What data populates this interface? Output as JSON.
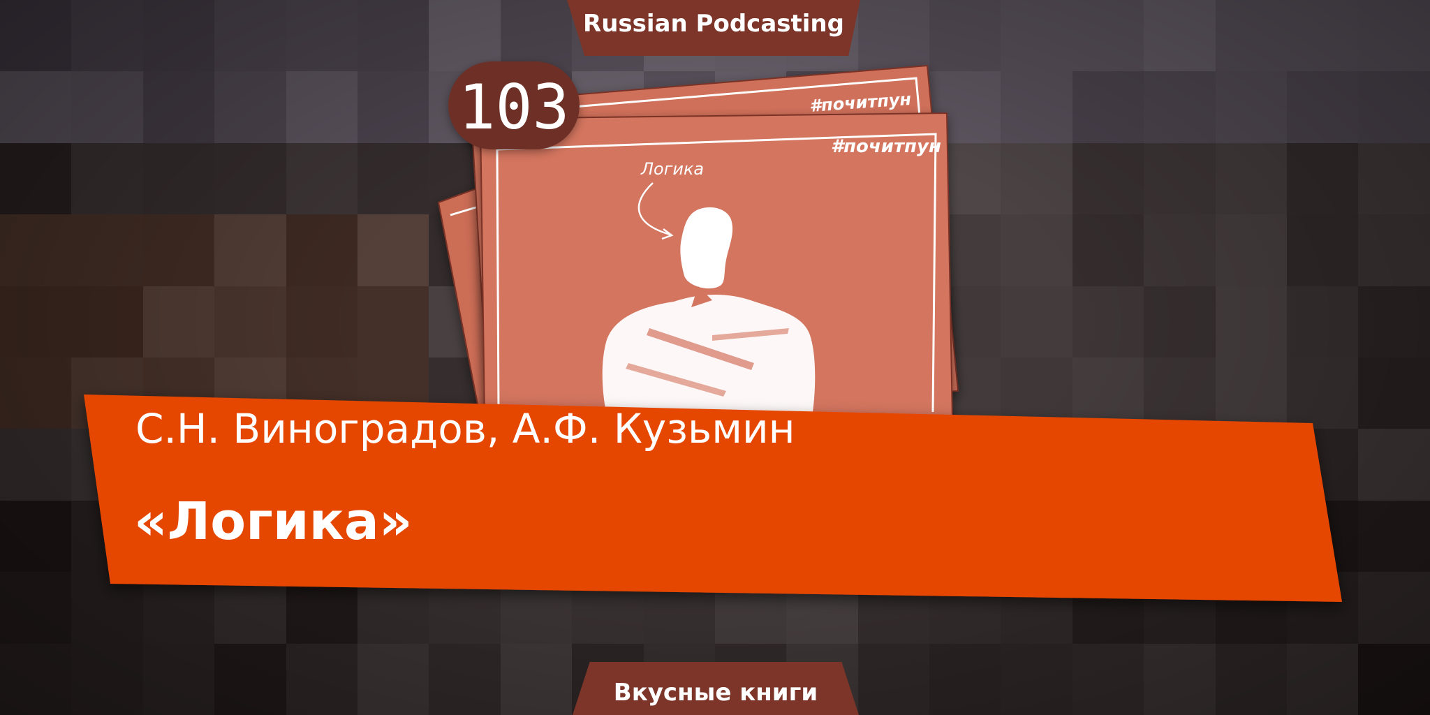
{
  "series": {
    "network": "Russian Podcasting",
    "show": "Вкусные книги"
  },
  "episode": {
    "number": "103",
    "authors": "С.Н. Виноградов, А.Ф. Кузьмин",
    "title": "«Логика»"
  },
  "cover": {
    "hashtag": "#почитпун",
    "caption": "Логика",
    "icon": "bust-portrait-icon"
  },
  "colors": {
    "banner": "#e64600",
    "tab": "#7c3528",
    "card": "#d2735c",
    "badge": "#6e3026",
    "text": "#ffffff"
  }
}
